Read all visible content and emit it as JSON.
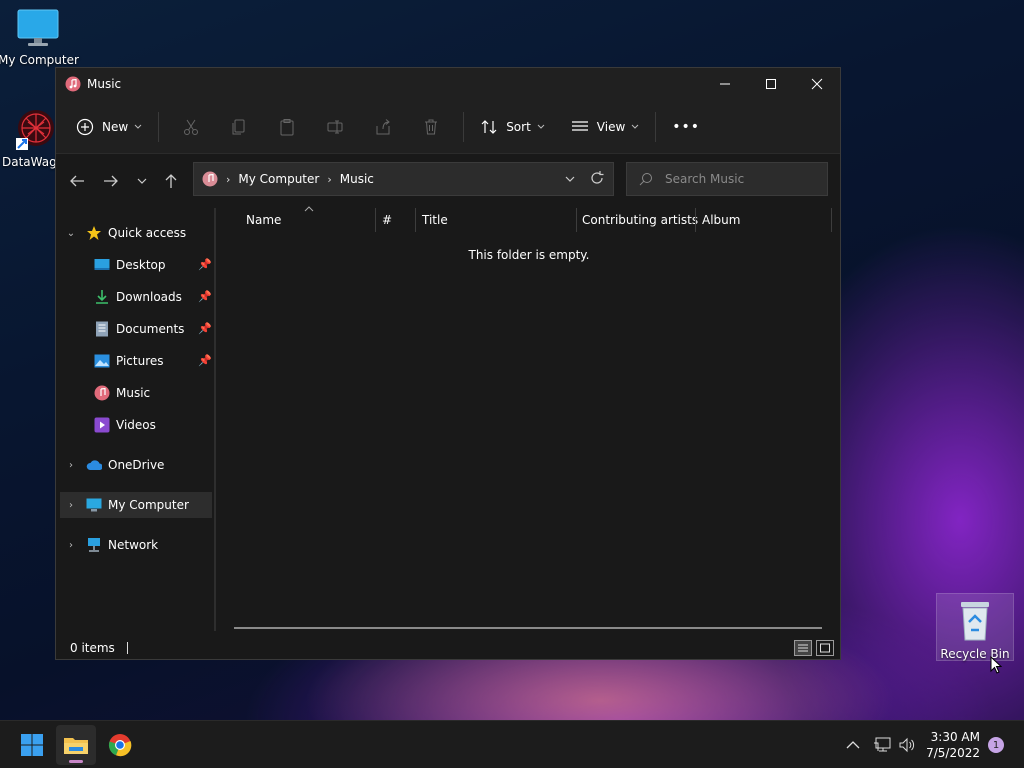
{
  "desktop": {
    "icons": [
      {
        "label": "My Computer"
      },
      {
        "label": "DataWago"
      },
      {
        "label": "Recycle Bin"
      }
    ]
  },
  "window": {
    "title": "Music",
    "controls": {
      "minimize": "minimize",
      "maximize": "maximize",
      "close": "close"
    }
  },
  "toolbar": {
    "new_label": "New",
    "sort_label": "Sort",
    "view_label": "View",
    "more_label": "•••"
  },
  "address": {
    "crumbs": [
      "My Computer",
      "Music"
    ],
    "search_placeholder": "Search Music"
  },
  "sidebar": {
    "items": [
      {
        "label": "Quick access"
      },
      {
        "label": "Desktop"
      },
      {
        "label": "Downloads"
      },
      {
        "label": "Documents"
      },
      {
        "label": "Pictures"
      },
      {
        "label": "Music"
      },
      {
        "label": "Videos"
      },
      {
        "label": "OneDrive"
      },
      {
        "label": "My Computer"
      },
      {
        "label": "Network"
      }
    ]
  },
  "content": {
    "columns": [
      "Name",
      "#",
      "Title",
      "Contributing artists",
      "Album"
    ],
    "empty_message": "This folder is empty."
  },
  "status": {
    "items_count": "0 items"
  },
  "taskbar": {
    "time": "3:30 AM",
    "date": "7/5/2022",
    "notifications": "1"
  },
  "colors": {
    "accent": "#0067c0",
    "window_bg": "#191919",
    "toolbar_bg": "#202020",
    "selected_bg": "#2d2d2d"
  }
}
